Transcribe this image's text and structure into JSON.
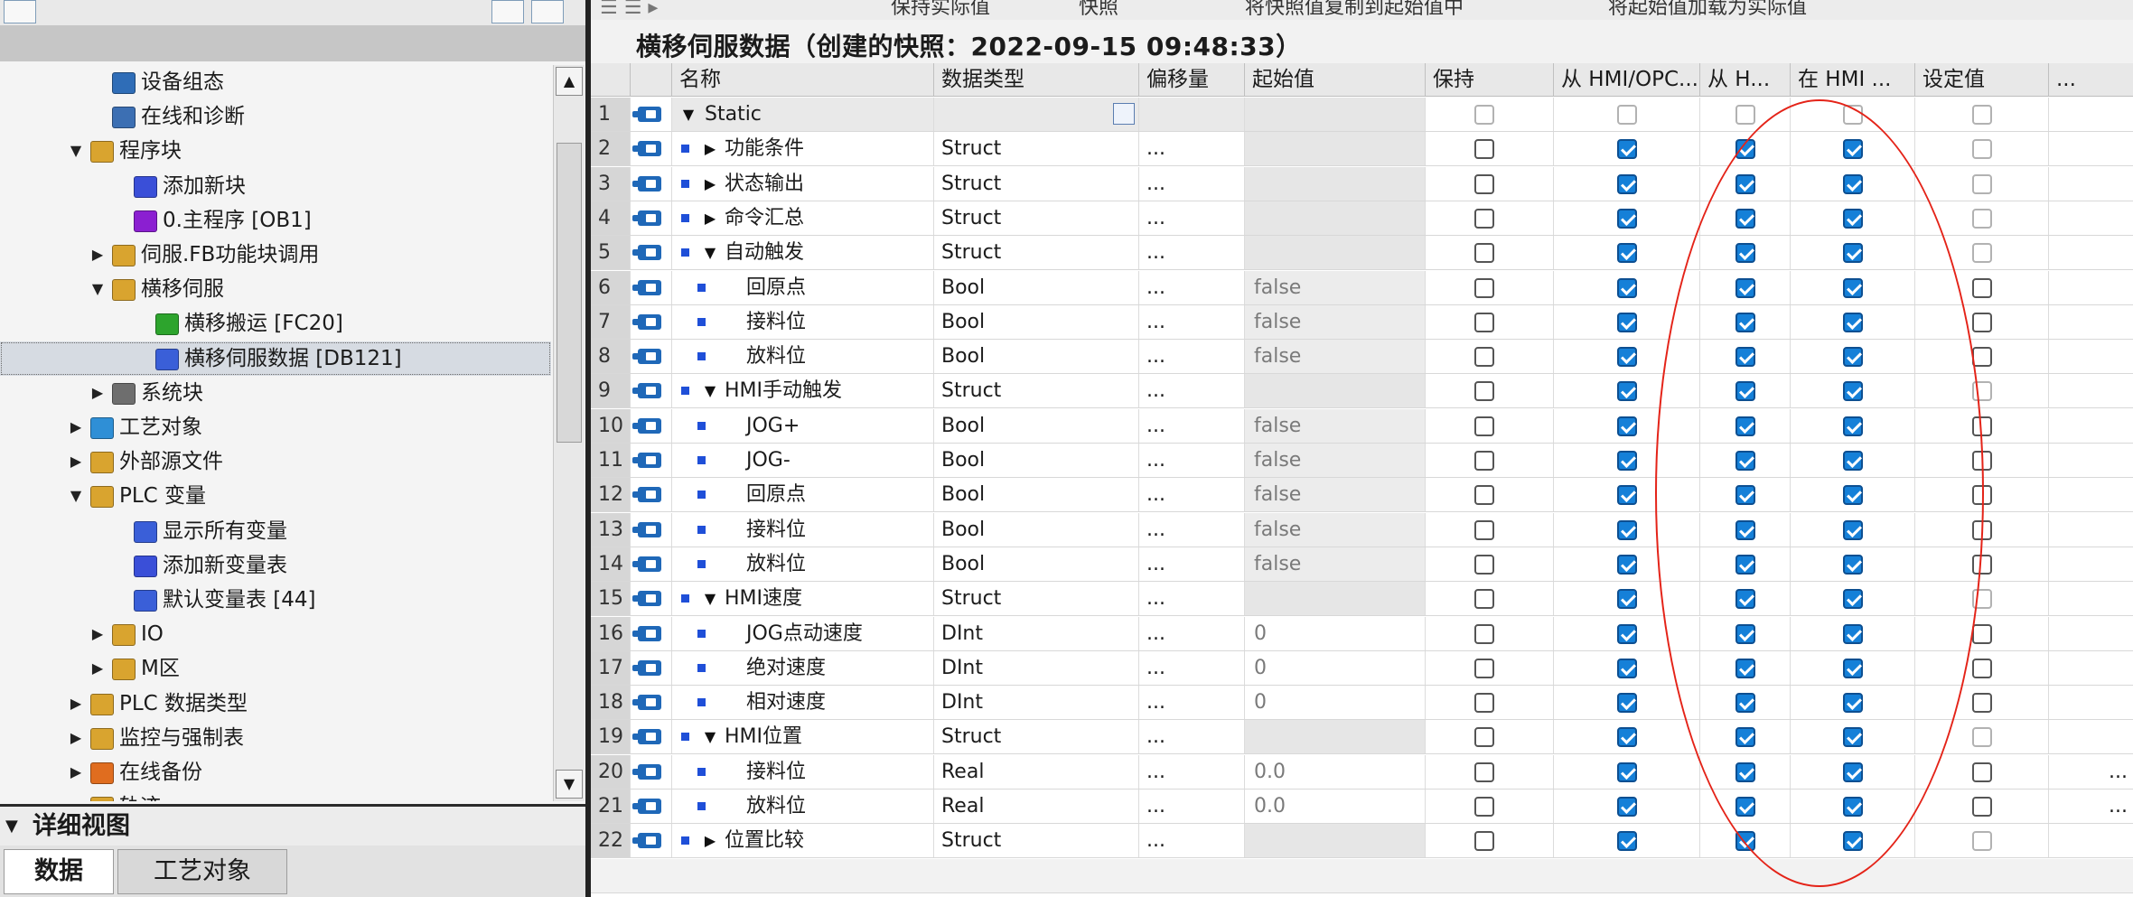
{
  "tree": {
    "items": [
      {
        "label": "设备组态",
        "indent": 3,
        "arrow": "",
        "icon": "device-config-icon",
        "color": "#2f6db7"
      },
      {
        "label": "在线和诊断",
        "indent": 3,
        "arrow": "",
        "icon": "online-diagnostics-icon",
        "color": "#3c6fb3"
      },
      {
        "label": "程序块",
        "indent": 2,
        "arrow": "down",
        "icon": "folder-icon",
        "color": "#d9a42f"
      },
      {
        "label": "添加新块",
        "indent": 4,
        "arrow": "",
        "icon": "add-block-icon",
        "color": "#3a4fd8"
      },
      {
        "label": "0.主程序 [OB1]",
        "indent": 4,
        "arrow": "",
        "icon": "ob-block-icon",
        "color": "#8b1fd1"
      },
      {
        "label": "伺服.FB功能块调用",
        "indent": 3,
        "arrow": "right",
        "icon": "folder-icon",
        "color": "#d9a42f"
      },
      {
        "label": "横移伺服",
        "indent": 3,
        "arrow": "down",
        "icon": "folder-icon",
        "color": "#d9a42f"
      },
      {
        "label": "横移搬运 [FC20]",
        "indent": 5,
        "arrow": "",
        "icon": "fc-block-icon",
        "color": "#2da42d"
      },
      {
        "label": "横移伺服数据 [DB121]",
        "indent": 5,
        "arrow": "",
        "icon": "db-block-icon",
        "color": "#3a5fd8",
        "selected": true
      },
      {
        "label": "系统块",
        "indent": 3,
        "arrow": "right",
        "icon": "system-block-icon",
        "color": "#6e6e6e"
      },
      {
        "label": "工艺对象",
        "indent": 2,
        "arrow": "right",
        "icon": "technology-object-icon",
        "color": "#2f8fd6"
      },
      {
        "label": "外部源文件",
        "indent": 2,
        "arrow": "right",
        "icon": "external-source-icon",
        "color": "#d9a42f"
      },
      {
        "label": "PLC 变量",
        "indent": 2,
        "arrow": "down",
        "icon": "plc-tags-folder-icon",
        "color": "#d9a42f"
      },
      {
        "label": "显示所有变量",
        "indent": 4,
        "arrow": "",
        "icon": "show-all-tags-icon",
        "color": "#3a5fd8"
      },
      {
        "label": "添加新变量表",
        "indent": 4,
        "arrow": "",
        "icon": "add-tag-table-icon",
        "color": "#3a4fd8"
      },
      {
        "label": "默认变量表 [44]",
        "indent": 4,
        "arrow": "",
        "icon": "tag-table-icon",
        "color": "#3a5fd8"
      },
      {
        "label": "IO",
        "indent": 3,
        "arrow": "right",
        "icon": "folder-icon",
        "color": "#d9a42f"
      },
      {
        "label": "M区",
        "indent": 3,
        "arrow": "right",
        "icon": "folder-icon",
        "color": "#d9a42f"
      },
      {
        "label": "PLC 数据类型",
        "indent": 2,
        "arrow": "right",
        "icon": "plc-datatype-icon",
        "color": "#d9a42f"
      },
      {
        "label": "监控与强制表",
        "indent": 2,
        "arrow": "right",
        "icon": "watch-table-icon",
        "color": "#d9a42f"
      },
      {
        "label": "在线备份",
        "indent": 2,
        "arrow": "right",
        "icon": "online-backup-icon",
        "color": "#e06d1f"
      },
      {
        "label": "轨迹",
        "indent": 2,
        "arrow": "right",
        "icon": "trace-icon",
        "color": "#d9a42f"
      }
    ]
  },
  "detail": {
    "title": "详细视图",
    "tabs": [
      "数据",
      "工艺对象"
    ]
  },
  "toolbar": {
    "items": [
      "保持实际值",
      "快照",
      "将快照值复制到起始值中",
      "将起始值加载为实际值"
    ]
  },
  "editor": {
    "title": "横移伺服数据（创建的快照：2022-09-15 09:48:33）",
    "columns": [
      "名称",
      "数据类型",
      "偏移量",
      "起始值",
      "保持",
      "从 HMI/OPC...",
      "从 H...",
      "在 HMI ...",
      "设定值"
    ],
    "rows": [
      {
        "n": "1",
        "name": "Static",
        "type": "",
        "offset": "",
        "start": "",
        "level": 0,
        "exp": "down",
        "sq": false,
        "checks": [
          0,
          0,
          0,
          0,
          0
        ]
      },
      {
        "n": "2",
        "name": "功能条件",
        "type": "Struct",
        "offset": "...",
        "start": "",
        "level": 1,
        "exp": "right",
        "sq": true,
        "checks": [
          0,
          1,
          1,
          1,
          2
        ]
      },
      {
        "n": "3",
        "name": "状态输出",
        "type": "Struct",
        "offset": "...",
        "start": "",
        "level": 1,
        "exp": "right",
        "sq": true,
        "checks": [
          0,
          1,
          1,
          1,
          2
        ]
      },
      {
        "n": "4",
        "name": "命令汇总",
        "type": "Struct",
        "offset": "...",
        "start": "",
        "level": 1,
        "exp": "right",
        "sq": true,
        "checks": [
          0,
          1,
          1,
          1,
          2
        ]
      },
      {
        "n": "5",
        "name": "自动触发",
        "type": "Struct",
        "offset": "...",
        "start": "",
        "level": 1,
        "exp": "down",
        "sq": true,
        "checks": [
          0,
          1,
          1,
          1,
          2
        ]
      },
      {
        "n": "6",
        "name": "回原点",
        "type": "Bool",
        "offset": "...",
        "start": "false",
        "level": 2,
        "exp": "",
        "sq": true,
        "checks": [
          0,
          1,
          1,
          1,
          0
        ]
      },
      {
        "n": "7",
        "name": "接料位",
        "type": "Bool",
        "offset": "...",
        "start": "false",
        "level": 2,
        "exp": "",
        "sq": true,
        "checks": [
          0,
          1,
          1,
          1,
          0
        ]
      },
      {
        "n": "8",
        "name": "放料位",
        "type": "Bool",
        "offset": "...",
        "start": "false",
        "level": 2,
        "exp": "",
        "sq": true,
        "checks": [
          0,
          1,
          1,
          1,
          0
        ]
      },
      {
        "n": "9",
        "name": "HMI手动触发",
        "type": "Struct",
        "offset": "...",
        "start": "",
        "level": 1,
        "exp": "down",
        "sq": true,
        "checks": [
          0,
          1,
          1,
          1,
          2
        ]
      },
      {
        "n": "10",
        "name": "JOG+",
        "type": "Bool",
        "offset": "...",
        "start": "false",
        "level": 2,
        "exp": "",
        "sq": true,
        "checks": [
          0,
          1,
          1,
          1,
          0
        ]
      },
      {
        "n": "11",
        "name": "JOG-",
        "type": "Bool",
        "offset": "...",
        "start": "false",
        "level": 2,
        "exp": "",
        "sq": true,
        "checks": [
          0,
          1,
          1,
          1,
          0
        ]
      },
      {
        "n": "12",
        "name": "回原点",
        "type": "Bool",
        "offset": "...",
        "start": "false",
        "level": 2,
        "exp": "",
        "sq": true,
        "checks": [
          0,
          1,
          1,
          1,
          0
        ]
      },
      {
        "n": "13",
        "name": "接料位",
        "type": "Bool",
        "offset": "...",
        "start": "false",
        "level": 2,
        "exp": "",
        "sq": true,
        "checks": [
          0,
          1,
          1,
          1,
          0
        ]
      },
      {
        "n": "14",
        "name": "放料位",
        "type": "Bool",
        "offset": "...",
        "start": "false",
        "level": 2,
        "exp": "",
        "sq": true,
        "checks": [
          0,
          1,
          1,
          1,
          0
        ]
      },
      {
        "n": "15",
        "name": "HMI速度",
        "type": "Struct",
        "offset": "...",
        "start": "",
        "level": 1,
        "exp": "down",
        "sq": true,
        "checks": [
          0,
          1,
          1,
          1,
          2
        ]
      },
      {
        "n": "16",
        "name": "JOG点动速度",
        "type": "DInt",
        "offset": "...",
        "start": "0",
        "level": 2,
        "exp": "",
        "sq": true,
        "checks": [
          0,
          1,
          1,
          1,
          0
        ]
      },
      {
        "n": "17",
        "name": "绝对速度",
        "type": "DInt",
        "offset": "...",
        "start": "0",
        "level": 2,
        "exp": "",
        "sq": true,
        "checks": [
          0,
          1,
          1,
          1,
          0
        ]
      },
      {
        "n": "18",
        "name": "相对速度",
        "type": "DInt",
        "offset": "...",
        "start": "0",
        "level": 2,
        "exp": "",
        "sq": true,
        "checks": [
          0,
          1,
          1,
          1,
          0
        ]
      },
      {
        "n": "19",
        "name": "HMI位置",
        "type": "Struct",
        "offset": "...",
        "start": "",
        "level": 1,
        "exp": "down",
        "sq": true,
        "checks": [
          0,
          1,
          1,
          1,
          2
        ]
      },
      {
        "n": "20",
        "name": "接料位",
        "type": "Real",
        "offset": "...",
        "start": "0.0",
        "level": 2,
        "exp": "",
        "sq": true,
        "checks": [
          0,
          1,
          1,
          1,
          0
        ],
        "tail": "..."
      },
      {
        "n": "21",
        "name": "放料位",
        "type": "Real",
        "offset": "...",
        "start": "0.0",
        "level": 2,
        "exp": "",
        "sq": true,
        "checks": [
          0,
          1,
          1,
          1,
          0
        ],
        "tail": "..."
      },
      {
        "n": "22",
        "name": "位置比较",
        "type": "Struct",
        "offset": "...",
        "start": "",
        "level": 1,
        "exp": "right",
        "sq": true,
        "checks": [
          0,
          1,
          1,
          1,
          2
        ]
      }
    ]
  },
  "colors": {
    "accent": "#1580d8",
    "annotation": "#e42318",
    "db_icon": "#1f68b8"
  }
}
